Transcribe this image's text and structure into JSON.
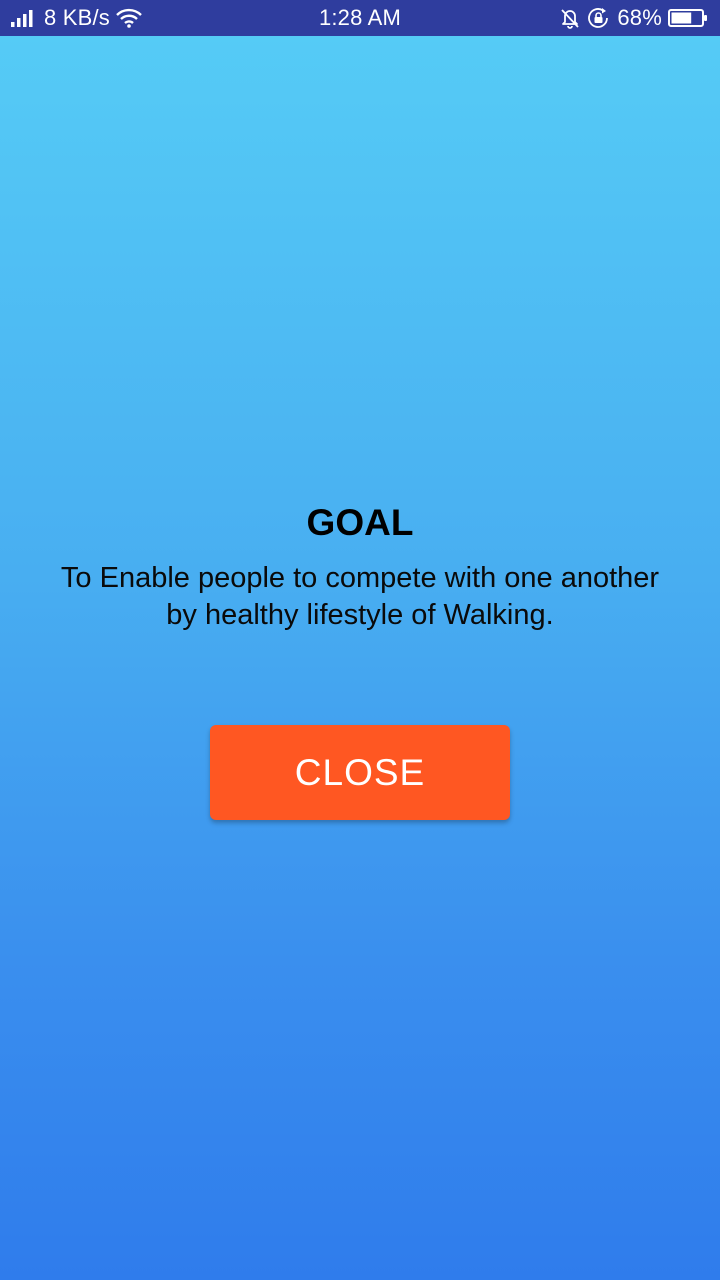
{
  "status_bar": {
    "network_speed": "8 KB/s",
    "time": "1:28 AM",
    "battery_percent": "68%",
    "battery_level": 0.68,
    "icons": [
      "signal-icon",
      "wifi-icon",
      "alarm-off-icon",
      "rotation-lock-icon",
      "battery-icon"
    ]
  },
  "dialog": {
    "title": "GOAL",
    "description": "To Enable people to compete with one another by healthy lifestyle of Walking.",
    "close_label": "CLOSE"
  },
  "colors": {
    "status_bar": "#2f3d9e",
    "background_top": "#56cdf6",
    "background_bottom": "#2f7cec",
    "button": "#ff5722",
    "button_text": "#ffffff",
    "text": "#000000"
  }
}
